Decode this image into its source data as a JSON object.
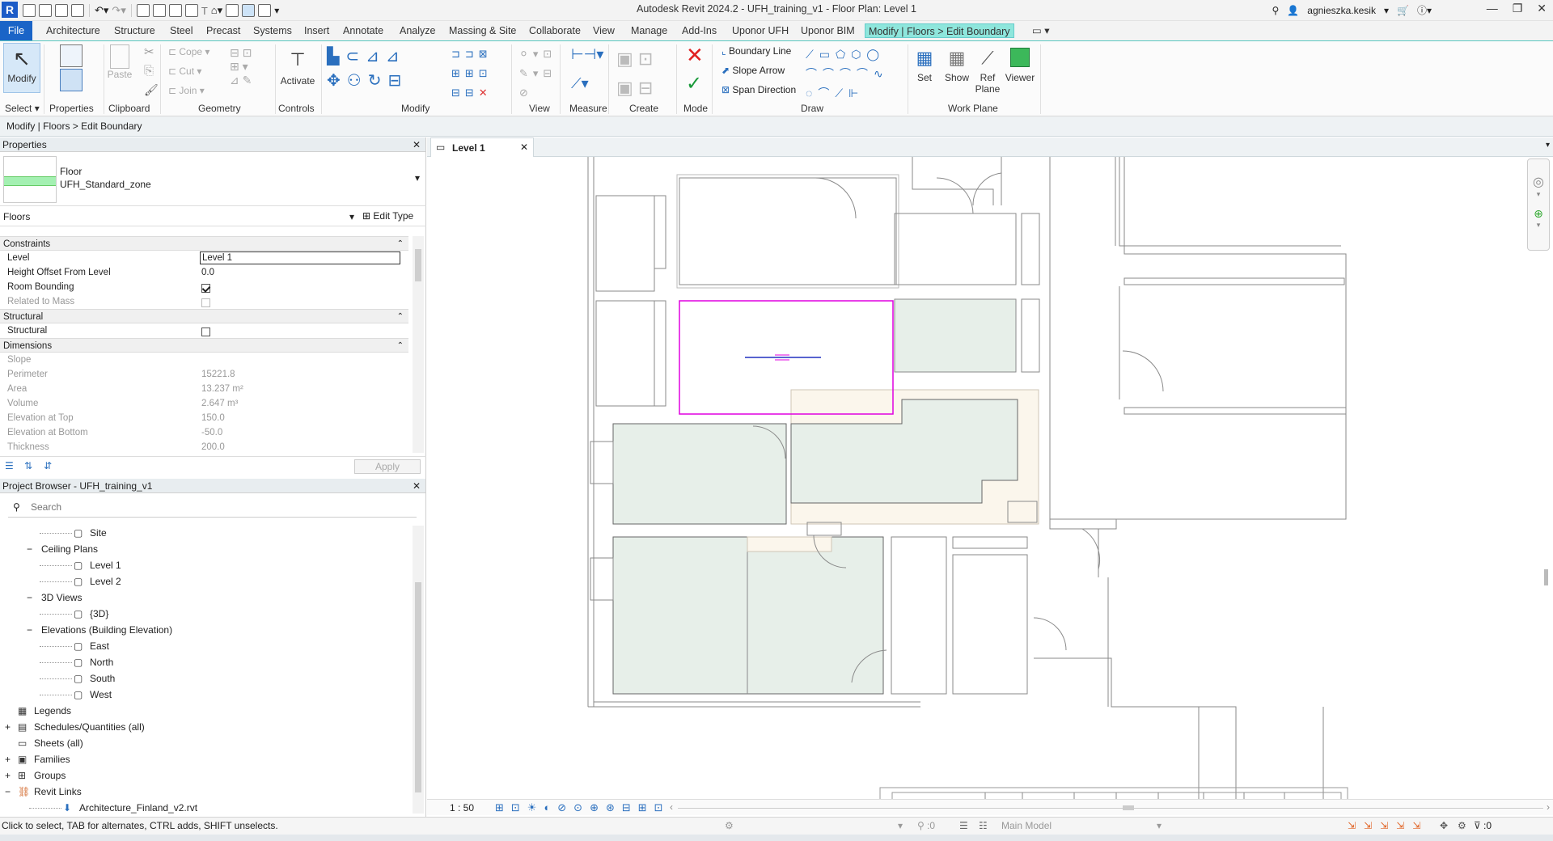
{
  "window": {
    "title": "Autodesk Revit 2024.2 - UFH_training_v1 - Floor Plan: Level 1",
    "app_logo": "R",
    "user": "agnieszka.kesik"
  },
  "tabs": {
    "file": "File",
    "architecture": "Architecture",
    "structure": "Structure",
    "steel": "Steel",
    "precast": "Precast",
    "systems": "Systems",
    "insert": "Insert",
    "annotate": "Annotate",
    "analyze": "Analyze",
    "massing": "Massing & Site",
    "collaborate": "Collaborate",
    "view": "View",
    "manage": "Manage",
    "addins": "Add-Ins",
    "uponor_ufh": "Uponor UFH",
    "uponor_bim": "Uponor BIM",
    "context": "Modify | Floors > Edit Boundary"
  },
  "ribbon": {
    "modify": "Modify",
    "select": "Select",
    "properties": "Properties",
    "paste": "Paste",
    "clipboard": "Clipboard",
    "cope": "Cope",
    "cut": "Cut",
    "join": "Join",
    "geometry": "Geometry",
    "activate": "Activate",
    "controls": "Controls",
    "modify_panel": "Modify",
    "view_panel": "View",
    "measure": "Measure",
    "create": "Create",
    "mode": "Mode",
    "boundary_line": "Boundary Line",
    "slope_arrow": "Slope Arrow",
    "span_direction": "Span Direction",
    "draw": "Draw",
    "set": "Set",
    "show": "Show",
    "ref_plane_1": "Ref",
    "ref_plane_2": "Plane",
    "viewer": "Viewer",
    "work_plane": "Work Plane"
  },
  "options_bar": "Modify | Floors > Edit Boundary",
  "properties": {
    "title": "Properties",
    "type_family": "Floor",
    "type_name": "UFH_Standard_zone",
    "selector": "Floors",
    "edit_type": "Edit Type",
    "apply": "Apply",
    "rows": [
      {
        "label": "Constraints",
        "kind": "section"
      },
      {
        "label": "Level",
        "value": "Level 1",
        "kind": "edit"
      },
      {
        "label": "Height Offset From Level",
        "value": "0.0",
        "kind": "value"
      },
      {
        "label": "Room Bounding",
        "checked": true,
        "kind": "check"
      },
      {
        "label": "Related to Mass",
        "checked": false,
        "kind": "check-dim"
      },
      {
        "label": "Structural",
        "kind": "section"
      },
      {
        "label": "Structural",
        "checked": false,
        "kind": "check"
      },
      {
        "label": "Dimensions",
        "kind": "section"
      },
      {
        "label": "Slope",
        "value": "",
        "kind": "dim"
      },
      {
        "label": "Perimeter",
        "value": "15221.8",
        "kind": "dim"
      },
      {
        "label": "Area",
        "value": "13.237 m²",
        "kind": "dim"
      },
      {
        "label": "Volume",
        "value": "2.647 m³",
        "kind": "dim"
      },
      {
        "label": "Elevation at Top",
        "value": "150.0",
        "kind": "dim"
      },
      {
        "label": "Elevation at Bottom",
        "value": "-50.0",
        "kind": "dim"
      },
      {
        "label": "Thickness",
        "value": "200.0",
        "kind": "dim"
      }
    ]
  },
  "browser": {
    "title": "Project Browser - UFH_training_v1",
    "search_placeholder": "Search",
    "items": [
      {
        "label": "Site",
        "depth": 3,
        "icon": "view"
      },
      {
        "label": "Ceiling Plans",
        "depth": 1,
        "toggle": "−"
      },
      {
        "label": "Level 1",
        "depth": 3,
        "icon": "view"
      },
      {
        "label": "Level 2",
        "depth": 3,
        "icon": "view"
      },
      {
        "label": "3D Views",
        "depth": 1,
        "toggle": "−"
      },
      {
        "label": "{3D}",
        "depth": 3,
        "icon": "view"
      },
      {
        "label": "Elevations (Building Elevation)",
        "depth": 1,
        "toggle": "−"
      },
      {
        "label": "East",
        "depth": 3,
        "icon": "view"
      },
      {
        "label": "North",
        "depth": 3,
        "icon": "view"
      },
      {
        "label": "South",
        "depth": 3,
        "icon": "view"
      },
      {
        "label": "West",
        "depth": 3,
        "icon": "view"
      },
      {
        "label": "Legends",
        "depth": 0,
        "icon": "legend"
      },
      {
        "label": "Schedules/Quantities (all)",
        "depth": 0,
        "toggle": "+",
        "icon": "schedule"
      },
      {
        "label": "Sheets (all)",
        "depth": 0,
        "icon": "sheet"
      },
      {
        "label": "Families",
        "depth": 0,
        "toggle": "+",
        "icon": "family"
      },
      {
        "label": "Groups",
        "depth": 0,
        "toggle": "+",
        "icon": "group"
      },
      {
        "label": "Revit Links",
        "depth": 0,
        "toggle": "−",
        "icon": "link"
      },
      {
        "label": "Architecture_Finland_v2.rvt",
        "depth": 2,
        "icon": "rvt"
      }
    ]
  },
  "view_tab": "Level 1",
  "view_scale": "1 : 50",
  "status": {
    "hint": "Click to select, TAB for alternates, CTRL adds, SHIFT unselects.",
    "coord": ":0",
    "model": "Main Model",
    "filter": ":0"
  },
  "colors": {
    "file_tab": "#1a64c7",
    "context_tab": "#8ee6dc",
    "sketch_boundary": "#e000e0",
    "floor_fill": "#e7efe9",
    "beige_fill": "#fbf6ec"
  }
}
